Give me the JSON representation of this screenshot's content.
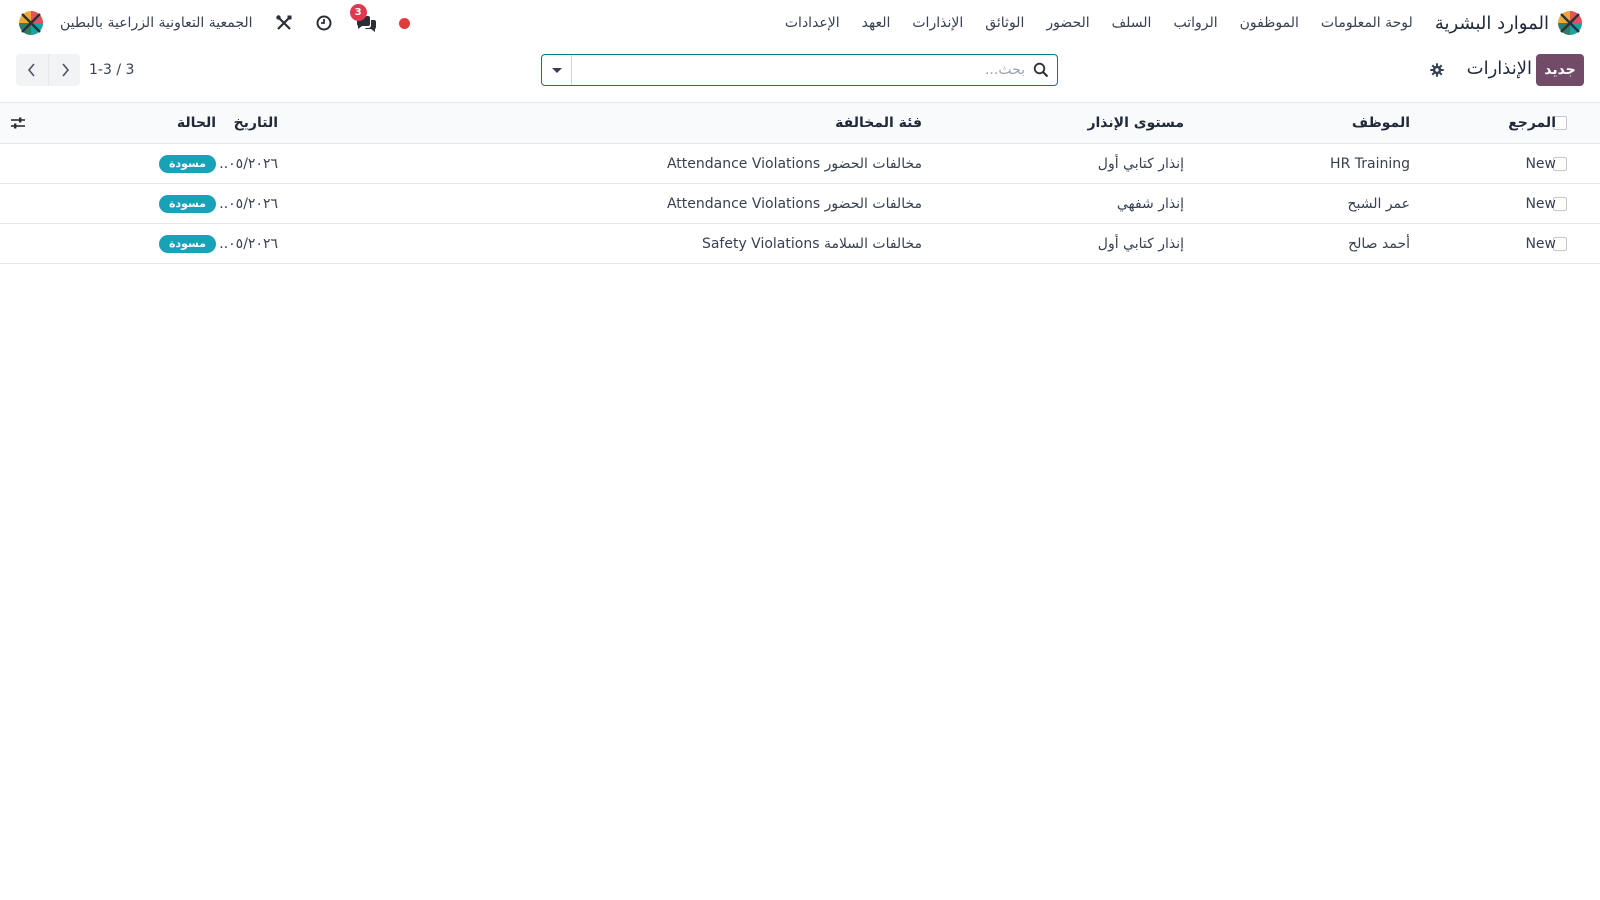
{
  "navbar": {
    "app_title": "الموارد البشرية",
    "menu": [
      "لوحة المعلومات",
      "الموظفون",
      "الرواتب",
      "السلف",
      "الحضور",
      "الوثائق",
      "الإنذارات",
      "العهد",
      "الإعدادات"
    ],
    "chat_badge": "3",
    "company_name": "الجمعية التعاونية الزراعية بالبطين"
  },
  "control_panel": {
    "new_label": "جديد",
    "title": "الإنذارات",
    "search_placeholder": "بحث...",
    "pager": "1-3 / 3"
  },
  "table": {
    "headers": {
      "reference": "المرجع",
      "employee": "الموظف",
      "level": "مستوى الإنذار",
      "category": "فئة المخالفة",
      "date": "التاريخ",
      "state": "الحالة"
    },
    "rows": [
      {
        "reference": "New",
        "employee": "HR Training",
        "level": "إنذار كتابي أول",
        "category": "مخالفات الحضور Attendance Violations",
        "date": "٠٥/٢٠٢٦...",
        "state": "مسودة"
      },
      {
        "reference": "New",
        "employee": "عمر الشبح",
        "level": "إنذار شفهي",
        "category": "مخالفات الحضور Attendance Violations",
        "date": "٠٥/٢٠٢٦...",
        "state": "مسودة"
      },
      {
        "reference": "New",
        "employee": "أحمد صالح",
        "level": "إنذار كتابي أول",
        "category": "مخالفات السلامة Safety Violations",
        "date": "٠٥/٢٠٢٦...",
        "state": "مسودة"
      }
    ]
  },
  "colors": {
    "primary": "#714b67",
    "accent": "#017e84",
    "badge_draft": "#17a2b8",
    "notification": "#e0384f",
    "status_dot": "#e03c3c"
  },
  "icons": {
    "app": "hr-app-icon",
    "chat": "chat-icon",
    "activity": "clock-icon",
    "debug": "tools-icon",
    "search": "search-icon",
    "settings": "gear-icon",
    "optional_columns": "sliders-icon"
  }
}
